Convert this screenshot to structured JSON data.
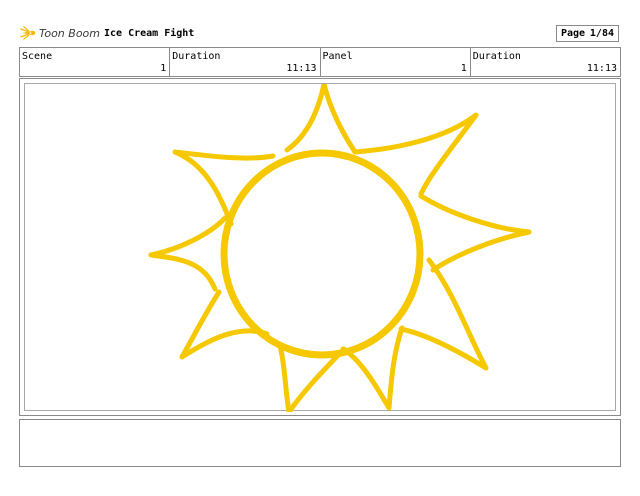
{
  "header": {
    "logo_text": "Toon Boom",
    "project_title": "Ice Cream Fight",
    "page_label": "Page",
    "page_value": "1/84"
  },
  "info": {
    "scene_label": "Scene",
    "scene_value": "1",
    "scene_duration_label": "Duration",
    "scene_duration_value": "11:13",
    "panel_label": "Panel",
    "panel_value": "1",
    "panel_duration_label": "Duration",
    "panel_duration_value": "11:13"
  },
  "drawing": {
    "subject": "sun-sketch",
    "stroke_color": "#F5C800"
  },
  "notes": {
    "text": ""
  },
  "colors": {
    "border": "#8a8a8a",
    "logo_accent": "#F5B800"
  }
}
